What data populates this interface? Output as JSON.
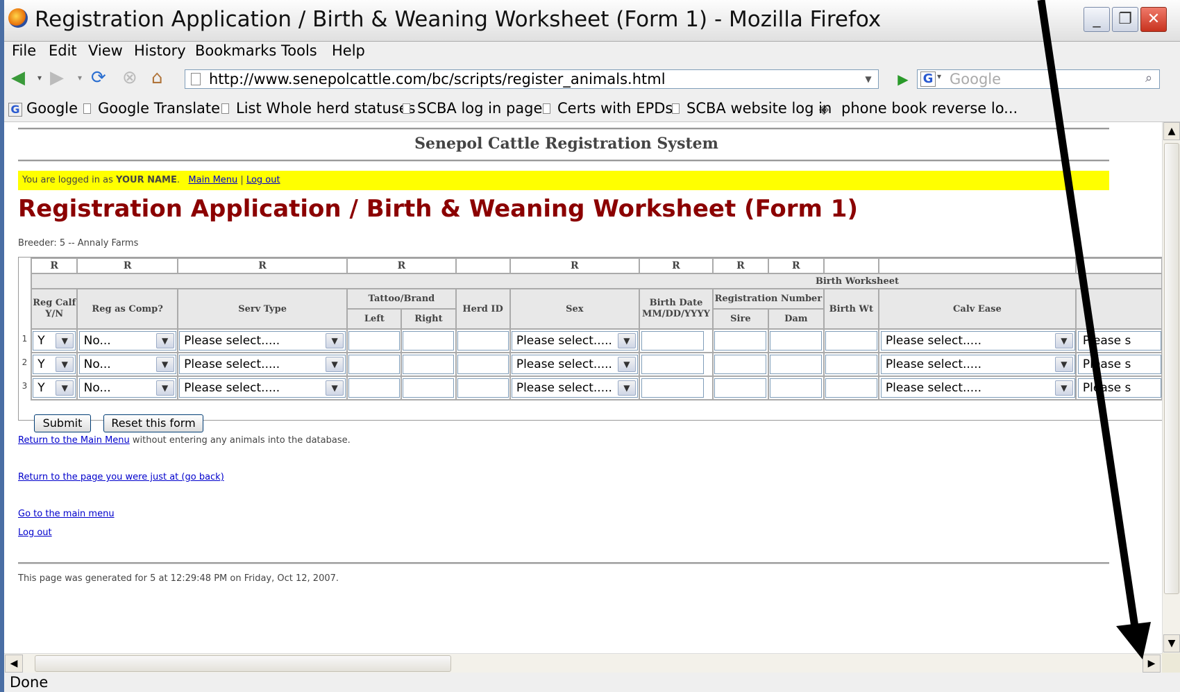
{
  "window": {
    "title": "Registration Application / Birth & Weaning Worksheet (Form 1) - Mozilla Firefox",
    "controls": {
      "minimize": "_",
      "maximize": "❐",
      "close": "✕"
    }
  },
  "menu": [
    "File",
    "Edit",
    "View",
    "History",
    "Bookmarks",
    "Tools",
    "Help"
  ],
  "nav": {
    "url": "http://www.senepolcattle.com/bc/scripts/register_animals.html",
    "search_placeholder": "Google"
  },
  "bookmarks": [
    "Google",
    "Google Translate",
    "List Whole herd statuses",
    "SCBA log in page",
    "Certs with EPDs",
    "SCBA website log in",
    "phone book reverse lo..."
  ],
  "page": {
    "system_title": "Senepol Cattle Registration System",
    "login": {
      "prefix": "You are logged in as ",
      "user": "YOUR NAME",
      "suffix": ".",
      "main_menu": "Main Menu",
      "sep": "|",
      "logout": "Log out"
    },
    "title": "Registration Application / Birth & Weaning Worksheet (Form 1)",
    "breeder": "Breeder: 5 -- Annaly Farms",
    "table": {
      "req_marker": "R",
      "group_label": "Birth Worksheet",
      "headers": {
        "reg_calf": "Reg Calf Y/N",
        "reg_comp": "Reg as Comp?",
        "serv_type": "Serv Type",
        "tattoo": "Tattoo/Brand",
        "left": "Left",
        "right": "Right",
        "herd_id": "Herd ID",
        "sex": "Sex",
        "birth_date": "Birth Date MM/DD/YYYY",
        "reg_number": "Registration Number",
        "sire": "Sire",
        "dam": "Dam",
        "birth_wt": "Birth Wt",
        "calv_ease": "Calv Ease"
      },
      "rows": [
        {
          "num": "1",
          "reg_calf": "Y",
          "reg_comp": "No...",
          "serv_type": "Please select.....",
          "sex": "Please select.....",
          "calv_ease": "Please select.....",
          "extra": "Please s"
        },
        {
          "num": "2",
          "reg_calf": "Y",
          "reg_comp": "No...",
          "serv_type": "Please select.....",
          "sex": "Please select.....",
          "calv_ease": "Please select.....",
          "extra": "Please s"
        },
        {
          "num": "3",
          "reg_calf": "Y",
          "reg_comp": "No...",
          "serv_type": "Please select.....",
          "sex": "Please select.....",
          "calv_ease": "Please select.....",
          "extra": "Please s"
        }
      ]
    },
    "buttons": {
      "submit": "Submit",
      "reset": "Reset this form"
    },
    "links": {
      "return_main": "Return to the Main Menu",
      "return_main_suffix": " without entering any animals into the database.",
      "go_back": "Return to the page you were just at (go back)",
      "main_menu": "Go to the main menu",
      "logout": "Log out"
    },
    "generated": "This page was generated for 5 at 12:29:48 PM on Friday, Oct 12, 2007."
  },
  "status": "Done"
}
